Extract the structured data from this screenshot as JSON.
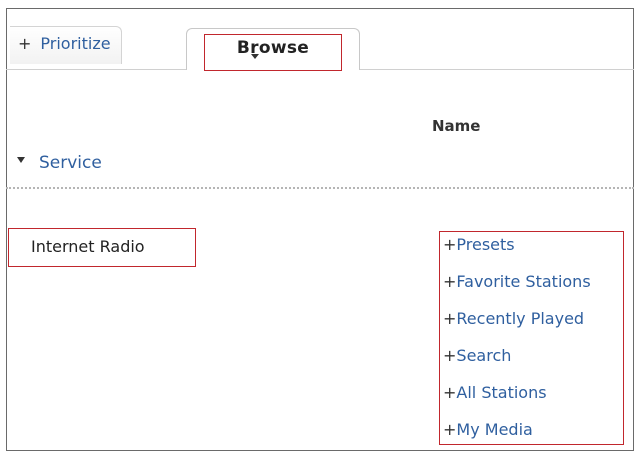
{
  "tabs": {
    "prioritize": {
      "prefix": "+",
      "label": "Prioritize"
    },
    "browse": {
      "label": "Browse"
    }
  },
  "table": {
    "column_header": "Name",
    "group_label": "Service",
    "row": {
      "service": "Internet Radio",
      "options": [
        {
          "prefix": "+",
          "label": "Presets"
        },
        {
          "prefix": "+",
          "label": "Favorite Stations"
        },
        {
          "prefix": "+",
          "label": "Recently Played"
        },
        {
          "prefix": "+",
          "label": "Search"
        },
        {
          "prefix": "+",
          "label": "All Stations"
        },
        {
          "prefix": "+",
          "label": "My Media"
        }
      ]
    }
  },
  "colors": {
    "link": "#2f5f9f",
    "highlight_box": "#c1272d"
  }
}
